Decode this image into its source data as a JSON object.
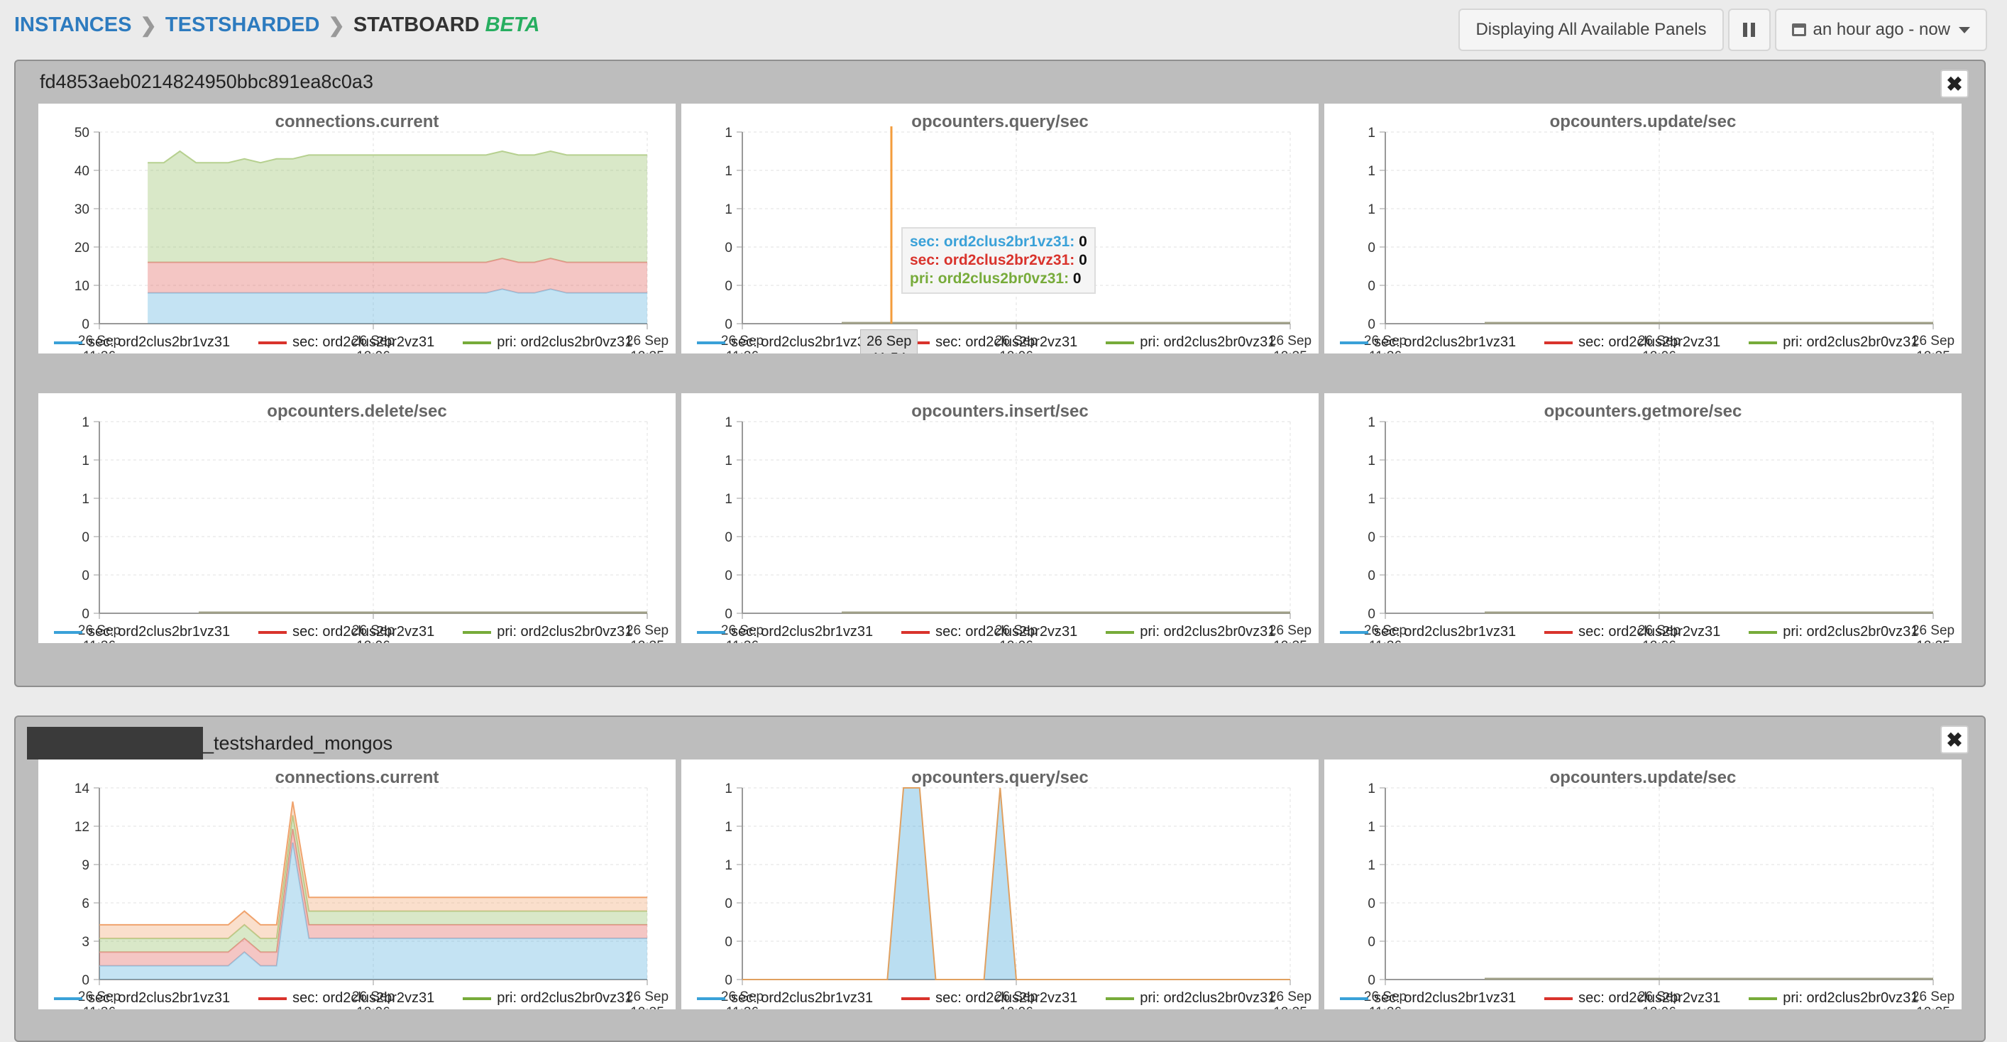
{
  "breadcrumb": {
    "instances": "INSTANCES",
    "testsharded": "TESTSHARDED",
    "current": "STATBOARD",
    "beta": "BETA"
  },
  "toolbar": {
    "panels_label": "Displaying All Available Panels",
    "time_range": "an hour ago - now"
  },
  "colors": {
    "sec1": "#3aa1d8",
    "sec2": "#d9332c",
    "pri": "#77ab3a",
    "mongos_orange": "#f0a36d"
  },
  "legend": [
    "sec: ord2clus2br1vz31",
    "sec: ord2clus2br2vz31",
    "pri: ord2clus2br0vz31"
  ],
  "groups": [
    {
      "title": "fd4853aeb0214824950bbc891ea8c0a3",
      "panels": [
        {
          "title": "connections.current"
        },
        {
          "title": "opcounters.query/sec"
        },
        {
          "title": "opcounters.update/sec"
        },
        {
          "title": "opcounters.delete/sec"
        },
        {
          "title": "opcounters.insert/sec"
        },
        {
          "title": "opcounters.getmore/sec"
        }
      ]
    },
    {
      "title": "_testsharded_mongos",
      "panels": [
        {
          "title": "connections.current"
        },
        {
          "title": "opcounters.query/sec"
        },
        {
          "title": "opcounters.update/sec"
        }
      ]
    }
  ],
  "tooltip": {
    "rows": [
      {
        "label": "sec: ord2clus2br1vz31:",
        "value": "0"
      },
      {
        "label": "sec: ord2clus2br2vz31:",
        "value": "0"
      },
      {
        "label": "pri: ord2clus2br0vz31:",
        "value": "0"
      }
    ],
    "x_line1": "26 Sep",
    "x_line2": "11:54"
  },
  "chart_data": [
    {
      "type": "area",
      "title": "connections.current",
      "x_ticks": [
        [
          "26 Sep",
          "11:36"
        ],
        [
          "26 Sep",
          "12:06"
        ],
        [
          "26 Sep",
          "12:35"
        ]
      ],
      "y_ticks": [
        "0",
        "10",
        "20",
        "30",
        "40",
        "50"
      ],
      "ylim": [
        0,
        50
      ],
      "series": [
        {
          "name": "sec: ord2clus2br1vz31",
          "values": [
            null,
            null,
            null,
            8,
            8,
            8,
            8,
            8,
            8,
            8,
            8,
            8,
            8,
            8,
            8,
            8,
            8,
            8,
            8,
            8,
            8,
            8,
            8,
            8,
            8,
            9,
            8,
            8,
            9,
            8,
            8,
            8,
            8,
            8,
            8
          ]
        },
        {
          "name": "sec: ord2clus2br2vz31",
          "values": [
            null,
            null,
            null,
            8,
            8,
            8,
            8,
            8,
            8,
            8,
            8,
            8,
            8,
            8,
            8,
            8,
            8,
            8,
            8,
            8,
            8,
            8,
            8,
            8,
            8,
            8,
            8,
            8,
            8,
            8,
            8,
            8,
            8,
            8,
            8
          ]
        },
        {
          "name": "pri: ord2clus2br0vz31",
          "values": [
            null,
            null,
            null,
            26,
            26,
            29,
            26,
            26,
            26,
            27,
            26,
            27,
            27,
            28,
            28,
            28,
            28,
            28,
            28,
            28,
            28,
            28,
            28,
            28,
            28,
            28,
            28,
            28,
            28,
            28,
            28,
            28,
            28,
            28,
            28
          ]
        }
      ]
    },
    {
      "type": "line",
      "title": "opcounters.query/sec",
      "y_ticks": [
        "0",
        "0",
        "0",
        "1",
        "1",
        "1"
      ],
      "ylim": [
        0,
        1
      ],
      "series": [
        {
          "name": "sec: ord2clus2br1vz31",
          "values": [
            0,
            0
          ]
        },
        {
          "name": "sec: ord2clus2br2vz31",
          "values": [
            0,
            0
          ]
        },
        {
          "name": "pri: ord2clus2br0vz31",
          "values": [
            0,
            0
          ]
        }
      ]
    },
    {
      "type": "line",
      "title": "opcounters.update/sec",
      "y_ticks": [
        "0",
        "0",
        "0",
        "1",
        "1",
        "1"
      ],
      "ylim": [
        0,
        1
      ],
      "series": [
        {
          "name": "sec: ord2clus2br1vz31",
          "values": [
            0,
            0
          ]
        },
        {
          "name": "sec: ord2clus2br2vz31",
          "values": [
            0,
            0
          ]
        },
        {
          "name": "pri: ord2clus2br0vz31",
          "values": [
            0,
            0
          ]
        }
      ]
    },
    {
      "type": "line",
      "title": "opcounters.delete/sec",
      "y_ticks": [
        "0",
        "0",
        "0",
        "1",
        "1",
        "1"
      ],
      "ylim": [
        0,
        1
      ],
      "series": [
        {
          "name": "sec: ord2clus2br1vz31",
          "values": [
            0,
            0
          ]
        },
        {
          "name": "sec: ord2clus2br2vz31",
          "values": [
            0,
            0
          ]
        },
        {
          "name": "pri: ord2clus2br0vz31",
          "values": [
            0,
            0
          ]
        }
      ]
    },
    {
      "type": "line",
      "title": "opcounters.insert/sec",
      "y_ticks": [
        "0",
        "0",
        "0",
        "1",
        "1",
        "1"
      ],
      "ylim": [
        0,
        1
      ],
      "series": [
        {
          "name": "sec: ord2clus2br1vz31",
          "values": [
            0,
            0
          ]
        },
        {
          "name": "sec: ord2clus2br2vz31",
          "values": [
            0,
            0
          ]
        },
        {
          "name": "pri: ord2clus2br0vz31",
          "values": [
            0,
            0
          ]
        }
      ]
    },
    {
      "type": "line",
      "title": "opcounters.getmore/sec",
      "y_ticks": [
        "0",
        "0",
        "0",
        "1",
        "1",
        "1"
      ],
      "ylim": [
        0,
        1
      ],
      "series": [
        {
          "name": "sec: ord2clus2br1vz31",
          "values": [
            0,
            0
          ]
        },
        {
          "name": "sec: ord2clus2br2vz31",
          "values": [
            0,
            0
          ]
        },
        {
          "name": "pri: ord2clus2br0vz31",
          "values": [
            0,
            0
          ]
        }
      ]
    },
    {
      "type": "area",
      "title": "connections.current",
      "y_ticks": [
        "0",
        "3",
        "6",
        "9",
        "12",
        "14"
      ],
      "ylim": [
        0,
        14
      ],
      "series": [
        {
          "values": [
            1,
            1,
            1,
            1,
            1,
            1,
            1,
            1,
            1,
            2,
            1,
            1,
            10,
            3,
            3,
            3,
            3,
            3,
            3,
            3,
            3,
            3,
            3,
            3,
            3,
            3,
            3,
            3,
            3,
            3,
            3,
            3,
            3,
            3,
            3
          ]
        },
        {
          "values": [
            1,
            1,
            1,
            1,
            1,
            1,
            1,
            1,
            1,
            1,
            1,
            1,
            1,
            1,
            1,
            1,
            1,
            1,
            1,
            1,
            1,
            1,
            1,
            1,
            1,
            1,
            1,
            1,
            1,
            1,
            1,
            1,
            1,
            1,
            1
          ]
        },
        {
          "values": [
            1,
            1,
            1,
            1,
            1,
            1,
            1,
            1,
            1,
            1,
            1,
            1,
            1,
            1,
            1,
            1,
            1,
            1,
            1,
            1,
            1,
            1,
            1,
            1,
            1,
            1,
            1,
            1,
            1,
            1,
            1,
            1,
            1,
            1,
            1
          ]
        },
        {
          "values": [
            1,
            1,
            1,
            1,
            1,
            1,
            1,
            1,
            1,
            1,
            1,
            1,
            1,
            1,
            1,
            1,
            1,
            1,
            1,
            1,
            1,
            1,
            1,
            1,
            1,
            1,
            1,
            1,
            1,
            1,
            1,
            1,
            1,
            1,
            1
          ]
        }
      ]
    },
    {
      "type": "area",
      "title": "opcounters.query/sec",
      "y_ticks": [
        "0",
        "0",
        "0",
        "1",
        "1",
        "1"
      ],
      "ylim": [
        0,
        1
      ],
      "series": [
        {
          "values": [
            0,
            0,
            0,
            0,
            0,
            0,
            0,
            0,
            0,
            0,
            1,
            1,
            0,
            0,
            0,
            0,
            1,
            0,
            0,
            0,
            0,
            0,
            0,
            0,
            0,
            0,
            0,
            0,
            0,
            0,
            0,
            0,
            0,
            0,
            0
          ]
        }
      ]
    },
    {
      "type": "line",
      "title": "opcounters.update/sec",
      "y_ticks": [
        "0",
        "0",
        "0",
        "1",
        "1",
        "1"
      ],
      "ylim": [
        0,
        1
      ],
      "series": [
        {
          "values": [
            0,
            0
          ]
        }
      ]
    }
  ]
}
